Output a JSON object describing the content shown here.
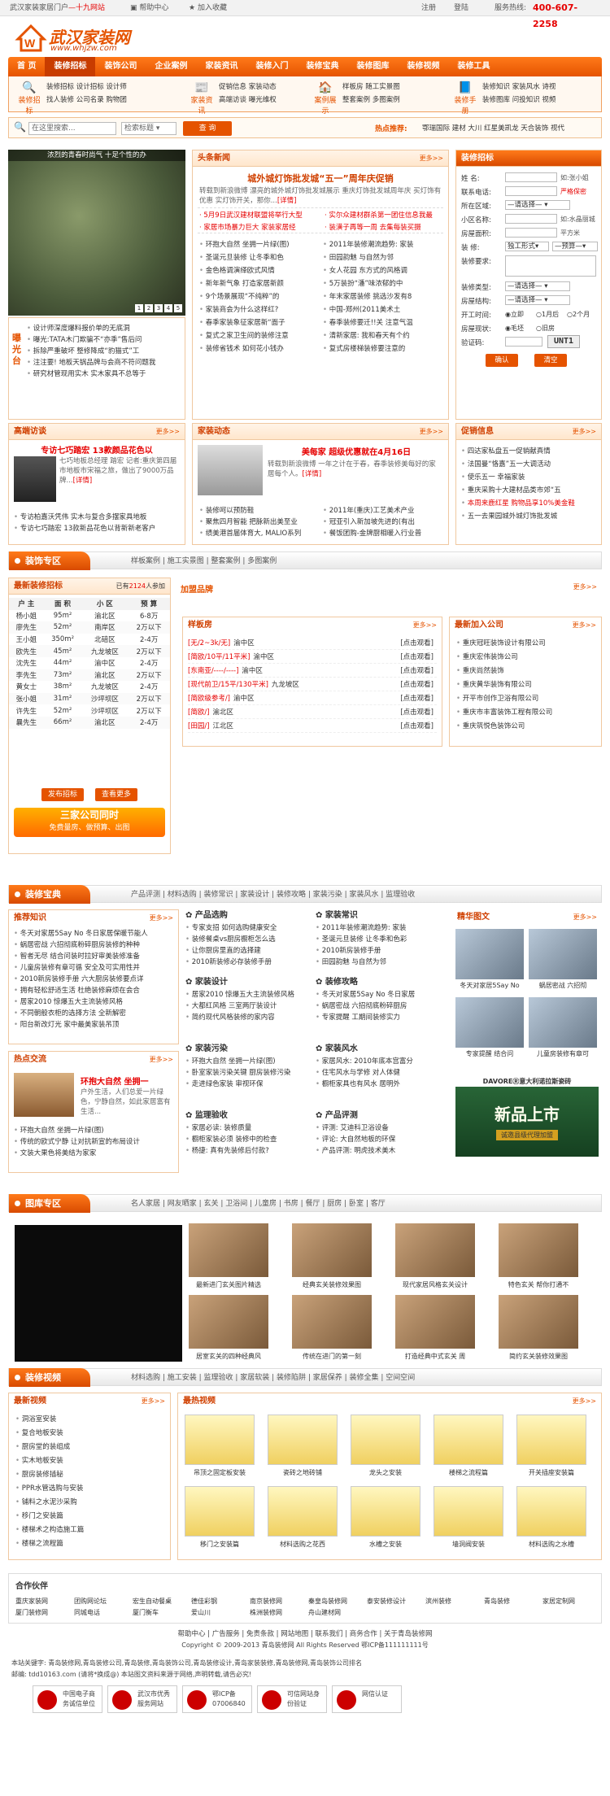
{
  "topbar": {
    "site": "武汉家装家居门户",
    "site_tail": "—十九网站",
    "help": "帮助中心",
    "fav": "加入收藏",
    "register": "注册",
    "login": "登陆",
    "hotline_label": "服务热线:",
    "hotline": "400-607-2258"
  },
  "logo": {
    "cn": "武汉家装网",
    "url": "www.whjzw.com"
  },
  "nav": [
    "首  页",
    "装修招标",
    "装饰公司",
    "企业案例",
    "家装资讯",
    "装修入门",
    "装修宝典",
    "装修图库",
    "装修视频",
    "装修工具"
  ],
  "subnav": [
    {
      "icon": "装修招标",
      "l1": "装修招标  设计招标  设计师",
      "l2": "找人装修  公司名录  购物团"
    },
    {
      "icon": "家装资讯",
      "l1": "促销信息  家装动态",
      "l2": "高端访谈  曝光维权"
    },
    {
      "icon": "案例展示",
      "l1": "样板房  随工实景图",
      "l2": "整套案例  多图案例"
    },
    {
      "icon": "装修手册",
      "l1": "装修知识  家装风水  诗视",
      "l2": "装修图库  问投知识  视频"
    }
  ],
  "search": {
    "placeholder": "在这里搜索...",
    "select": "检索标题",
    "btn": "查  询",
    "hot_label": "热点推荐:",
    "hot": "鄂瑞国际 建材 大川 红星美凯龙 天合装饰 视代"
  },
  "slide": {
    "caption": "浓烈的青春时尚气 十足个性的办",
    "pages": [
      "1",
      "2",
      "3",
      "4",
      "5"
    ]
  },
  "headline": {
    "tab": "头条新闻",
    "more": "更多>>",
    "title": "城外城灯饰批发城“五一”周年庆促销",
    "desc": "转载到新浪微博 漂亮的城外城灯饰批发城展示 重庆灯饰批发城周年庆 买灯饰有优惠 实灯饰开关，那你...",
    "desc_link": "[详情]",
    "reds": [
      [
        "· 5月9日武汉建材联盟将举行大型",
        "· 实尔众建材群杀第一团住信息我最"
      ],
      [
        "· 家居市场暴力巨大 家装家居经",
        "· 装潢子再等一周 去集每装买摄"
      ]
    ],
    "left": [
      "环抱大自然 坐拥一片绿(图)",
      "圣诞元旦装修 让冬季和色",
      "金色格调演绎欧式风情",
      "新年新气象 打造家居新颜",
      "9个场景展现“不纯粹”的",
      "家装商会为什么这样红?",
      "春季家装象征家居新“面子",
      "复式之家卫生间的装修注意",
      "装修省钱术  如何花小钱办"
    ],
    "right": [
      "2011年装修潮流趋势: 家装",
      "田园韵魅 与自然为邻",
      "女人花园 东方式的风格调",
      "5万装扮“潘”味浓郁的中",
      "年末家居装修 挑选沙发有8",
      "中国-郑州(2011美术土",
      "春季装修要迁!!关 注意气温",
      "清新家居: 我和春天有个约",
      "复式房楼梯装修要注意的"
    ]
  },
  "tender": {
    "title": "装修招标",
    "fields": {
      "name": "姓      名:",
      "name_tip": "如:张小姐",
      "contact": "联系电话:",
      "contact_tip": "严格保密",
      "area": "所在区域:",
      "area_val": "—请选择—",
      "estate": "小区名称:",
      "estate_tip": "如:水晶丽城",
      "size": "房屋面积:",
      "size_unit": "平方米",
      "type": "装      修:",
      "type_v1": "独工形式",
      "type_v2": "—预算—",
      "req": "装修要求:",
      "kind": "装修类型:",
      "kind_val": "—请选择—",
      "struct": "房屋结构:",
      "struct_val": "—请选择—",
      "start": "开工时间:",
      "start_opts": [
        "立即",
        "1月后",
        "2个月"
      ],
      "status": "房屋现状:",
      "status_opts": [
        "毛坯",
        "旧房"
      ],
      "code": "验证码:",
      "code_img": "UNT1",
      "ok": "确认",
      "reset": "清空"
    }
  },
  "crystal": {
    "label": "曝光台",
    "items": [
      "设计师深度爆料报价单的无底洞",
      "曝光:TATA木门欺骗不“亦季”售后问",
      "拆除严重破坏 整修降成“豹猫式”工",
      "注注要! 地板天锅品牌与会商不符问题我",
      "研究材管现用实木 实木家具不总等于"
    ]
  },
  "interview": {
    "title": "高端访谈",
    "more": "更多>>",
    "head": "专访七巧踏宏 13款颜品花色以",
    "desc": "七巧地板总经理 踏宏 记者:重庆第四届市地板市宋福之旅，做出了9000万品牌...",
    "link": "[详情]",
    "items": [
      "专访柏嘉沃凭伟 实木与复合多摆家具地板",
      "专访七巧踏宏 13款新品花色以背新新老客户"
    ]
  },
  "news": {
    "title": "家装动态",
    "more": "更多>>",
    "head": "美每家 超级优惠就在4月16日",
    "desc": "转载到新浪微博 一年之计在于春，春季装修美每好的家居每个人。",
    "link": "[详情]",
    "left": [
      "装修呵以预防鞋",
      "聚焦四月智能 把脉新出美至业",
      "绩美港首届体育大, MALIO系列"
    ],
    "right": [
      "2011年(重庆)工艺美术产业",
      "冠亚引入新加坡先进的(有出",
      "餐饭团购-金牌厨相暖入行业普"
    ]
  },
  "promo": {
    "title": "促销信息",
    "more": "更多>>",
    "items": [
      "四达家私盘五一促销献真情",
      "法国曼“恪嘉”五一大调活动",
      "使乐五一 幸福家装",
      "重庆采购十大建材品类市郊“五",
      "本周来鹿红星 购物品享10%美金鞋",
      "五一去果园城外城灯饰批发城"
    ]
  },
  "sec1": {
    "title": "装饰专区",
    "links": "样板案例 | 施工实景图 | 整套案例 | 多图案例"
  },
  "latest_tender": {
    "title": "最新装修招标",
    "count_pre": "已有",
    "count": "2124",
    "count_post": "人参加",
    "cols": [
      "户 主",
      "面 积",
      "小 区",
      "预 算"
    ],
    "rows": [
      [
        "杨小姐",
        "95m²",
        "渝北区",
        "6-8万"
      ],
      [
        "廖先生",
        "52m²",
        "南岸区",
        "2万以下"
      ],
      [
        "王小姐",
        "350m²",
        "北碚区",
        "2-4万"
      ],
      [
        "欧先生",
        "45m²",
        "九龙坡区",
        "2万以下"
      ],
      [
        "沈先生",
        "44m²",
        "渝中区",
        "2-4万"
      ],
      [
        "李先生",
        "73m²",
        "渝北区",
        "2万以下"
      ],
      [
        "黄女士",
        "38m²",
        "九龙坡区",
        "2-4万"
      ],
      [
        "张小姐",
        "31m²",
        "沙坪坝区",
        "2万以下"
      ],
      [
        "许先生",
        "52m²",
        "沙坪坝区",
        "2万以下"
      ],
      [
        "曩先生",
        "66m²",
        "渝北区",
        "2-4万"
      ]
    ],
    "btn1": "发布招标",
    "btn2": "查看更多",
    "ad1": "三家公司同时",
    "ad2": "免费量房、做预算、出图"
  },
  "brand": {
    "title": "加盟品牌",
    "more": "更多>>"
  },
  "sample": {
    "title": "样板房",
    "more": "更多>>",
    "rows": [
      [
        "[无/2~3k/无]",
        "渝中区",
        "[点击观看]"
      ],
      [
        "[简欧/10平/11平米]",
        "渝中区",
        "[点击观看]"
      ],
      [
        "[东南亚/----/----]",
        "渝中区",
        "[点击观看]"
      ],
      [
        "[现代前卫/15平/130平米]",
        "九龙坡区",
        "[点击观看]"
      ],
      [
        "[简欧级参考/]",
        "渝中区",
        "[点击观看]"
      ],
      [
        "[简欧/]",
        "渝北区",
        "[点击观看]"
      ],
      [
        "[田园/]",
        "江北区",
        "[点击观看]"
      ]
    ]
  },
  "newco": {
    "title": "最新加入公司",
    "more": "更多>>",
    "items": [
      "重庆冠旺装饰设计有限公司",
      "重庆宏伟装饰公司",
      "重庆尚然装饰",
      "重庆黄华装饰有限公司",
      "开平市创作卫浴有限公司",
      "重庆市丰富装饰工程有限公司",
      "重庆筑悦色装饰公司"
    ]
  },
  "sec2": {
    "title": "装修宝典",
    "links": "产品评测 | 材料选购 | 装修常识 | 家装设计 | 装修攻略 | 家装污染 | 家装风水 | 监理验收"
  },
  "knowledge": {
    "title": "推荐知识",
    "more": "更多>>",
    "items": [
      "冬天对家居5Say No 冬日家居保暖节能人",
      "蜗居密战 六招彻底粉碎厨房装修的种种",
      "智者无尽 结合问装时拉好审美装修准备",
      "儿童房装修有章可循 安全及可实用性并",
      "2010新房装修手册 六大厨房装修要点详",
      "拥有轻松舒适生活 杜绝装修麻烦在会合",
      "居家2010 惊爆五大主流装修风格",
      "不同朝般衣柜的选择方法 全新解密",
      "阳台新改灯光 家中最美家装吊顶"
    ]
  },
  "hot": {
    "title": "热点交流",
    "more": "更多>>",
    "head": "环抱大自然 坐拥一",
    "desc": "户外生活，人们总爱一片绿色，宁静自然，如此家居富有生活...",
    "items": [
      "环抱大自然 坐拥一片绿(图)",
      "传统的欧式宁静 让对抗新宣的布局设计",
      "文装大果色将美结为家家"
    ]
  },
  "cats": [
    {
      "t": "产品选购",
      "i": [
        "专家支招 如何选购健康安全",
        "装修餐桌vs厨房橱柜怎么选",
        "让你厨房里直的选择建",
        "2010新装修必存装修手册"
      ]
    },
    {
      "t": "家装常识",
      "i": [
        "2011年装修潮流趋势: 家装",
        "圣诞元旦装修 让冬季和色彩",
        "2010新房装修手册",
        "田园韵魅 与自然为邻"
      ]
    },
    {
      "t": "家装设计",
      "i": [
        "居家2010 惊爆五大主流装修风格",
        "大都红风格 三室两厅装设计",
        "简约现代风格装修的家内容"
      ]
    },
    {
      "t": "装修攻略",
      "i": [
        "冬天对家居5Say No 冬日家居",
        "蜗居密战 六招彻底粉碎厨房",
        "专家提醒 工期间装修实力"
      ]
    },
    {
      "t": "家装污染",
      "i": [
        "环抱大自然 坐拥一片绿(图)",
        "卧室家装污染关键 厨房装修污染",
        "走进绿色家装 审视环保"
      ]
    },
    {
      "t": "家装风水",
      "i": [
        "家居风水: 2010年底本宫富分",
        "住宅风水与学修 对人体健",
        "橱柜家具也有风水 居明外"
      ]
    },
    {
      "t": "监理验收",
      "i": [
        "家居必读: 装修质量",
        "橱柜家装必须 装修中的检查",
        "杨捷: 真有先装修后付款?"
      ]
    },
    {
      "t": "产品评测",
      "i": [
        "评测: 艾迪科卫浴设备",
        "评论: 大自然地板的环保",
        "产品评测: 明虎技术美木"
      ]
    }
  ],
  "pics": {
    "title": "精华图文",
    "more": "更多>>",
    "caps": [
      "冬天对家居5Say No",
      "蜗居密战 六招彻",
      "专家提醒 结合问",
      "儿童房装修有章可"
    ],
    "ad1": "DAVOREⓇ意大利诺拉斯瓷砖",
    "ad2": "新品上市",
    "ad3": "诚邀县级代理加盟"
  },
  "sec3": {
    "title": "图库专区",
    "links": "名人家居 | 网友晒家 | 玄关 | 卫浴间 | 儿童房 | 书房 | 餐厅 | 厨房 | 卧室 | 客厅"
  },
  "gallery": [
    "最新进门玄关图片精选",
    "经典玄关装修效果图",
    "现代家居风格玄关设计",
    "特色玄关  帮你打通不",
    "居室玄关的四种经典风",
    "传统在进门的第一刻",
    "打造经典中式玄关 周",
    "简约玄关装修效果图"
  ],
  "sec4": {
    "title": "装修视频",
    "links": "材料选购 | 施工安装 | 监理验收 | 家居软装 | 装修陷阱 | 家居保养 | 装修全集 | 空间空间"
  },
  "vlist": {
    "title": "最新视频",
    "more": "更多>>",
    "items": [
      "洞浴室安装",
      "复合地板安装",
      "厨房堂的装组成",
      "实木地板安装",
      "厨房装修插秘",
      "PPR水管选购与安装",
      "铺料之水泥沙采购",
      "移门之安装篇",
      "楼梯术之构造施工篇",
      "楼梯之流程篇"
    ]
  },
  "vgrid": {
    "title": "最热视频",
    "more": "更多>>",
    "caps": [
      "吊顶之固定板安装",
      "瓷砖之地砖铺",
      "龙头之安装",
      "楼梯之流程篇",
      "开关插座安装篇",
      "移门之安装篇",
      "材料选购之花西",
      "水槽之安装",
      "墙洞阀安装",
      "材料选购之水槽"
    ]
  },
  "partners": {
    "title": "合作伙伴",
    "items": [
      "重庆家装网",
      "团购网论坛",
      "宏生自动餐桌",
      "德佳彩钢",
      "南京装修网",
      "秦皇岛装修网",
      "泰安装修设计",
      "滨州装修",
      "青岛装修",
      "家居定制网",
      "厦门装修网",
      "同城电话",
      "厦门衡车",
      "爱山川",
      "株洲装修网",
      "舟山建材网"
    ]
  },
  "footer": {
    "links": "帮助中心  |  广告服务  |  免责条款  |  网站地图  |  联系我们  |  商务合作  |  关于青岛装修网",
    "copy": "Copyright © 2009-2013 青岛装修网 All Rights Reserved 鄂ICP备111111111号",
    "l1": "本站关键字: 青岛装修网,青岛装修公司,青岛装修,青岛装饰公司,青岛装修设计,青岛家装装修,青岛装修网,青岛装饰公司排名",
    "l2": "邮编: tdd10163.com (请将*换成@)  本站图文资料来源于网络,声明转载,请告必究!",
    "badges": [
      "中国电子商务诚信单位",
      "武汉市优秀服务网站",
      "鄂ICP备07006840",
      "可信网站身份验证",
      "网信认证"
    ]
  }
}
